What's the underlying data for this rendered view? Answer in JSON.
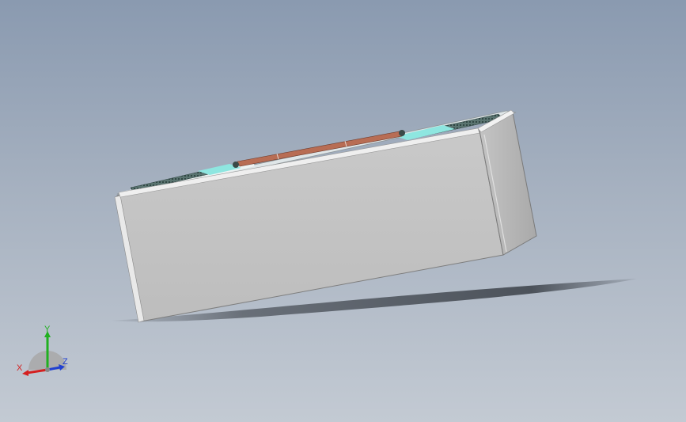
{
  "viewport": {
    "background_top": "#8a9ab0",
    "background_bottom": "#c3cad3"
  },
  "model": {
    "body_color": "#c6c6c6",
    "side_color": "#b3b3b3",
    "top_plate_color": "#e6ecee",
    "grille_color": "#3f5b57",
    "accent_cyan": "#8ee6e0",
    "bar_color": "#b86d54"
  },
  "triad": {
    "x_label": "X",
    "y_label": "Y",
    "z_label": "Z",
    "x_color": "#d42020",
    "y_color": "#20b020",
    "z_color": "#2040d0"
  }
}
